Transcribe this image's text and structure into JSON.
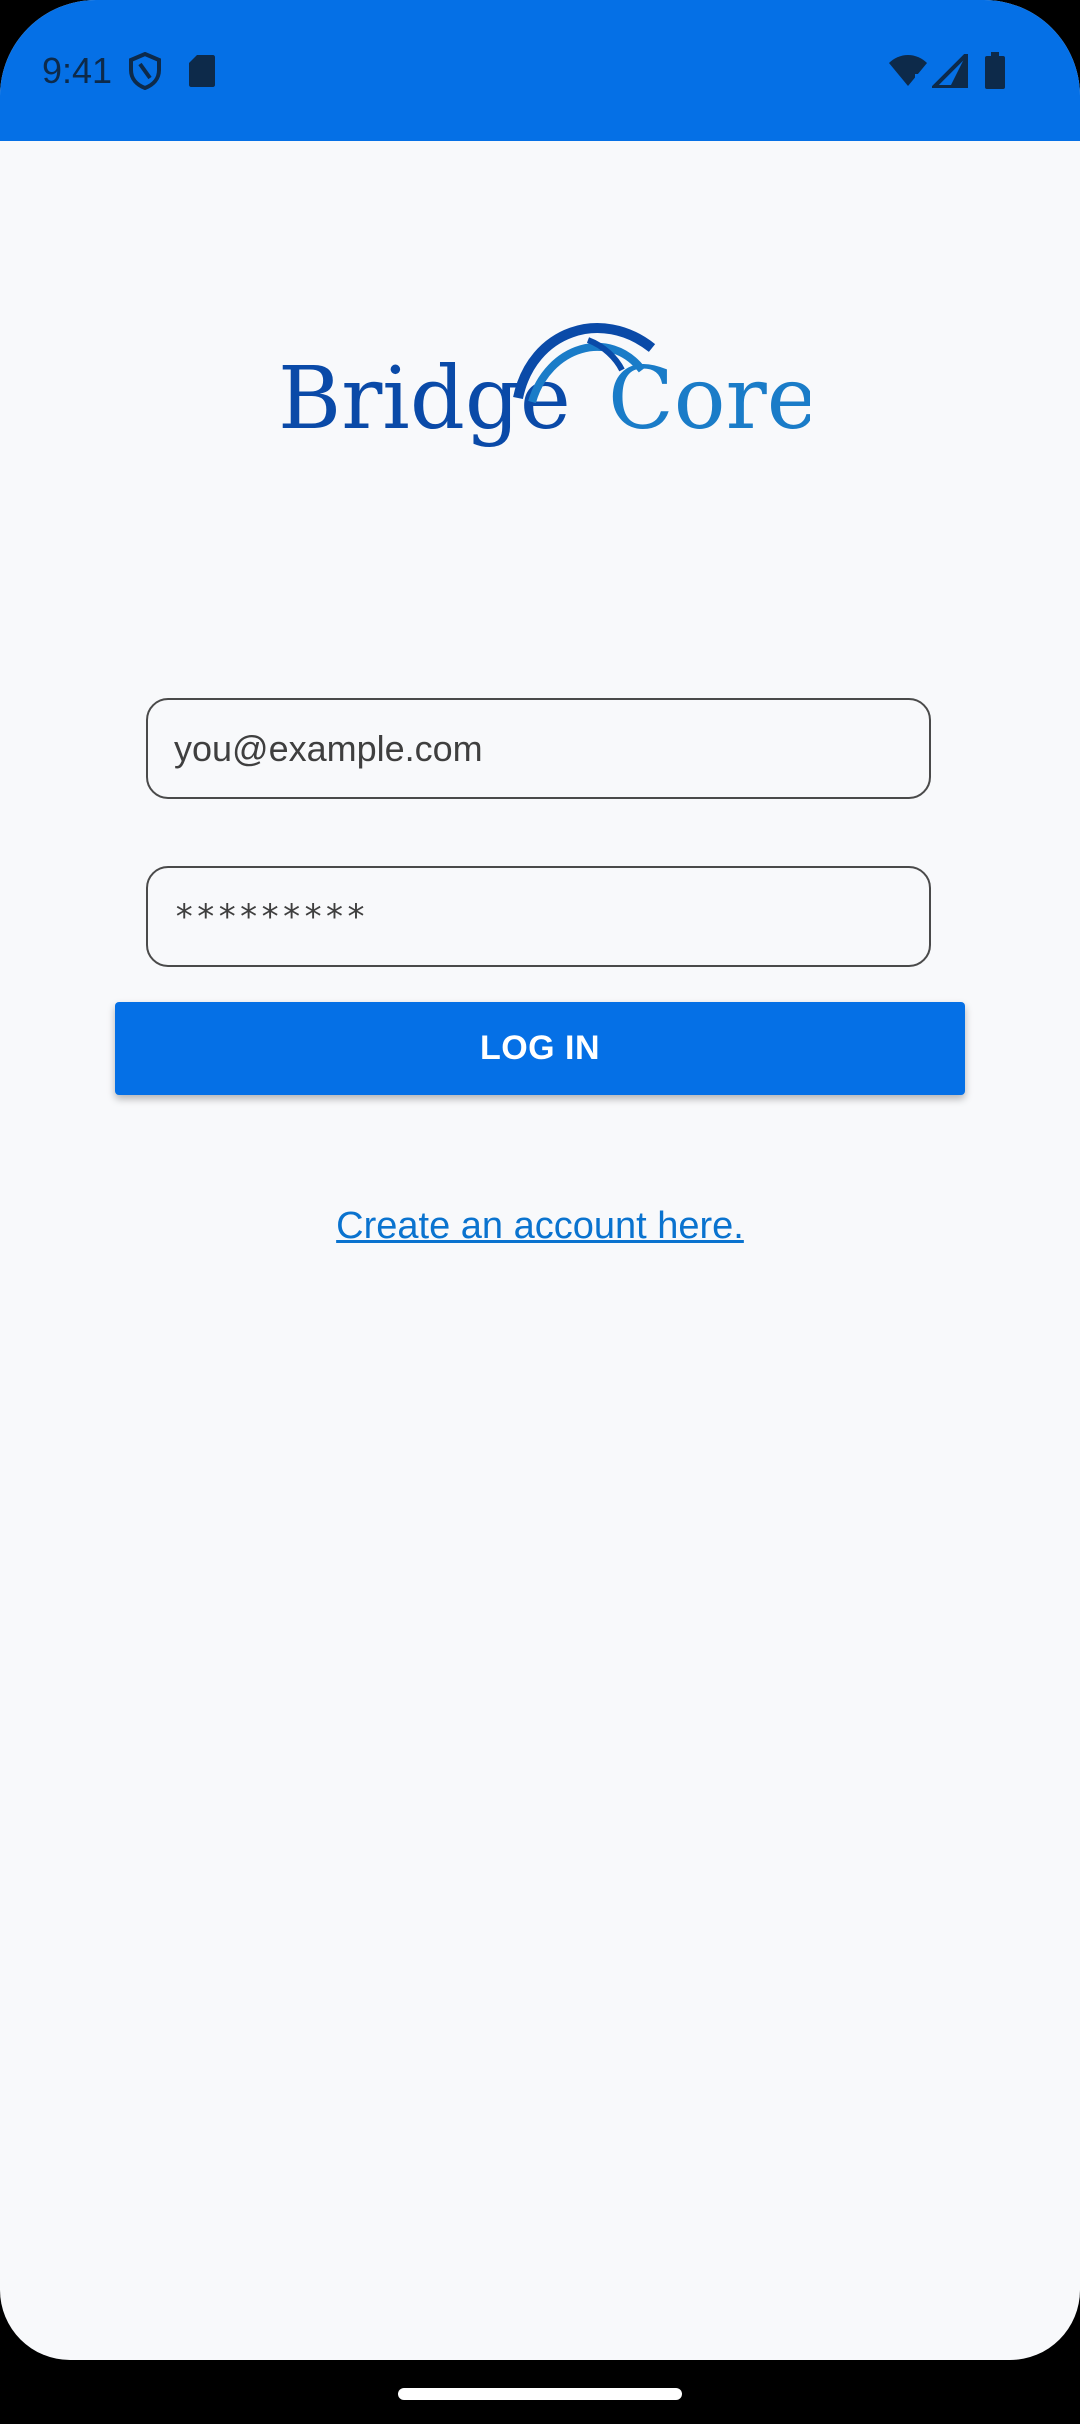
{
  "status_bar": {
    "time": "9:41",
    "icons": [
      "shield-icon",
      "sd-card-icon",
      "wifi-icon",
      "signal-icon",
      "battery-icon"
    ],
    "color": "#0570e6"
  },
  "logo": {
    "word1": "Bridge",
    "word2": "Core",
    "color_dark": "#0a4aa8",
    "color_light": "#1a7cc8"
  },
  "form": {
    "email_placeholder": "you@example.com",
    "password_value": "*********",
    "login_label": "LOG IN"
  },
  "create_account_link": "Create an account here.",
  "colors": {
    "accent": "#0570e6",
    "background": "#f8f9fb",
    "link": "#0a73cf"
  }
}
